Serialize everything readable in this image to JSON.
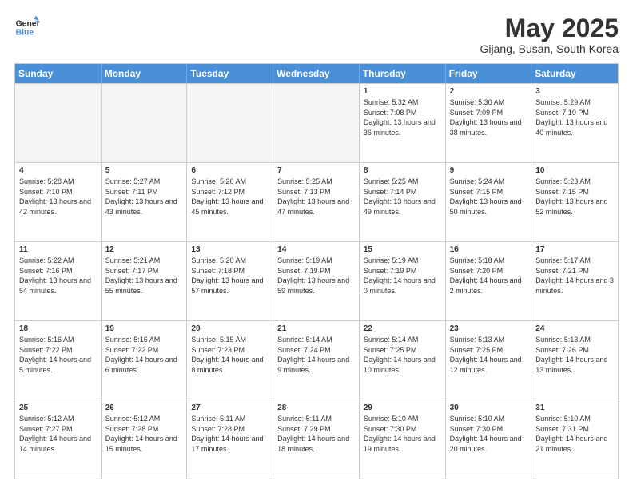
{
  "header": {
    "logo_line1": "General",
    "logo_line2": "Blue",
    "month": "May 2025",
    "location": "Gijang, Busan, South Korea"
  },
  "days_of_week": [
    "Sunday",
    "Monday",
    "Tuesday",
    "Wednesday",
    "Thursday",
    "Friday",
    "Saturday"
  ],
  "weeks": [
    [
      {
        "day": "",
        "empty": true
      },
      {
        "day": "",
        "empty": true
      },
      {
        "day": "",
        "empty": true
      },
      {
        "day": "",
        "empty": true
      },
      {
        "day": "1",
        "sunrise": "Sunrise: 5:32 AM",
        "sunset": "Sunset: 7:08 PM",
        "daylight": "Daylight: 13 hours and 36 minutes."
      },
      {
        "day": "2",
        "sunrise": "Sunrise: 5:30 AM",
        "sunset": "Sunset: 7:09 PM",
        "daylight": "Daylight: 13 hours and 38 minutes."
      },
      {
        "day": "3",
        "sunrise": "Sunrise: 5:29 AM",
        "sunset": "Sunset: 7:10 PM",
        "daylight": "Daylight: 13 hours and 40 minutes."
      }
    ],
    [
      {
        "day": "4",
        "sunrise": "Sunrise: 5:28 AM",
        "sunset": "Sunset: 7:10 PM",
        "daylight": "Daylight: 13 hours and 42 minutes."
      },
      {
        "day": "5",
        "sunrise": "Sunrise: 5:27 AM",
        "sunset": "Sunset: 7:11 PM",
        "daylight": "Daylight: 13 hours and 43 minutes."
      },
      {
        "day": "6",
        "sunrise": "Sunrise: 5:26 AM",
        "sunset": "Sunset: 7:12 PM",
        "daylight": "Daylight: 13 hours and 45 minutes."
      },
      {
        "day": "7",
        "sunrise": "Sunrise: 5:25 AM",
        "sunset": "Sunset: 7:13 PM",
        "daylight": "Daylight: 13 hours and 47 minutes."
      },
      {
        "day": "8",
        "sunrise": "Sunrise: 5:25 AM",
        "sunset": "Sunset: 7:14 PM",
        "daylight": "Daylight: 13 hours and 49 minutes."
      },
      {
        "day": "9",
        "sunrise": "Sunrise: 5:24 AM",
        "sunset": "Sunset: 7:15 PM",
        "daylight": "Daylight: 13 hours and 50 minutes."
      },
      {
        "day": "10",
        "sunrise": "Sunrise: 5:23 AM",
        "sunset": "Sunset: 7:15 PM",
        "daylight": "Daylight: 13 hours and 52 minutes."
      }
    ],
    [
      {
        "day": "11",
        "sunrise": "Sunrise: 5:22 AM",
        "sunset": "Sunset: 7:16 PM",
        "daylight": "Daylight: 13 hours and 54 minutes."
      },
      {
        "day": "12",
        "sunrise": "Sunrise: 5:21 AM",
        "sunset": "Sunset: 7:17 PM",
        "daylight": "Daylight: 13 hours and 55 minutes."
      },
      {
        "day": "13",
        "sunrise": "Sunrise: 5:20 AM",
        "sunset": "Sunset: 7:18 PM",
        "daylight": "Daylight: 13 hours and 57 minutes."
      },
      {
        "day": "14",
        "sunrise": "Sunrise: 5:19 AM",
        "sunset": "Sunset: 7:19 PM",
        "daylight": "Daylight: 13 hours and 59 minutes."
      },
      {
        "day": "15",
        "sunrise": "Sunrise: 5:19 AM",
        "sunset": "Sunset: 7:19 PM",
        "daylight": "Daylight: 14 hours and 0 minutes."
      },
      {
        "day": "16",
        "sunrise": "Sunrise: 5:18 AM",
        "sunset": "Sunset: 7:20 PM",
        "daylight": "Daylight: 14 hours and 2 minutes."
      },
      {
        "day": "17",
        "sunrise": "Sunrise: 5:17 AM",
        "sunset": "Sunset: 7:21 PM",
        "daylight": "Daylight: 14 hours and 3 minutes."
      }
    ],
    [
      {
        "day": "18",
        "sunrise": "Sunrise: 5:16 AM",
        "sunset": "Sunset: 7:22 PM",
        "daylight": "Daylight: 14 hours and 5 minutes."
      },
      {
        "day": "19",
        "sunrise": "Sunrise: 5:16 AM",
        "sunset": "Sunset: 7:22 PM",
        "daylight": "Daylight: 14 hours and 6 minutes."
      },
      {
        "day": "20",
        "sunrise": "Sunrise: 5:15 AM",
        "sunset": "Sunset: 7:23 PM",
        "daylight": "Daylight: 14 hours and 8 minutes."
      },
      {
        "day": "21",
        "sunrise": "Sunrise: 5:14 AM",
        "sunset": "Sunset: 7:24 PM",
        "daylight": "Daylight: 14 hours and 9 minutes."
      },
      {
        "day": "22",
        "sunrise": "Sunrise: 5:14 AM",
        "sunset": "Sunset: 7:25 PM",
        "daylight": "Daylight: 14 hours and 10 minutes."
      },
      {
        "day": "23",
        "sunrise": "Sunrise: 5:13 AM",
        "sunset": "Sunset: 7:25 PM",
        "daylight": "Daylight: 14 hours and 12 minutes."
      },
      {
        "day": "24",
        "sunrise": "Sunrise: 5:13 AM",
        "sunset": "Sunset: 7:26 PM",
        "daylight": "Daylight: 14 hours and 13 minutes."
      }
    ],
    [
      {
        "day": "25",
        "sunrise": "Sunrise: 5:12 AM",
        "sunset": "Sunset: 7:27 PM",
        "daylight": "Daylight: 14 hours and 14 minutes."
      },
      {
        "day": "26",
        "sunrise": "Sunrise: 5:12 AM",
        "sunset": "Sunset: 7:28 PM",
        "daylight": "Daylight: 14 hours and 15 minutes."
      },
      {
        "day": "27",
        "sunrise": "Sunrise: 5:11 AM",
        "sunset": "Sunset: 7:28 PM",
        "daylight": "Daylight: 14 hours and 17 minutes."
      },
      {
        "day": "28",
        "sunrise": "Sunrise: 5:11 AM",
        "sunset": "Sunset: 7:29 PM",
        "daylight": "Daylight: 14 hours and 18 minutes."
      },
      {
        "day": "29",
        "sunrise": "Sunrise: 5:10 AM",
        "sunset": "Sunset: 7:30 PM",
        "daylight": "Daylight: 14 hours and 19 minutes."
      },
      {
        "day": "30",
        "sunrise": "Sunrise: 5:10 AM",
        "sunset": "Sunset: 7:30 PM",
        "daylight": "Daylight: 14 hours and 20 minutes."
      },
      {
        "day": "31",
        "sunrise": "Sunrise: 5:10 AM",
        "sunset": "Sunset: 7:31 PM",
        "daylight": "Daylight: 14 hours and 21 minutes."
      }
    ]
  ]
}
